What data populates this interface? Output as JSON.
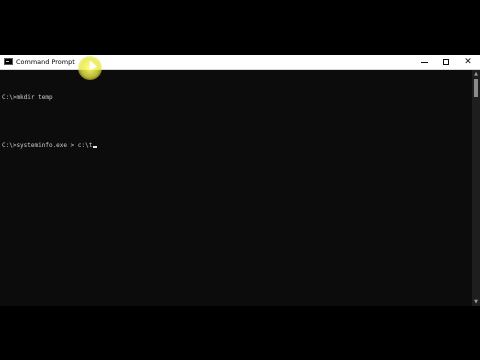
{
  "window": {
    "title": "Command Prompt",
    "controls": {
      "minimize": "minimize",
      "maximize": "maximize",
      "close": "✕"
    }
  },
  "console": {
    "lines": [
      "C:\\>mkdir temp",
      "",
      "C:\\>systeminfo.exe > c:\\t"
    ]
  },
  "scrollbar": {
    "up": "▲",
    "down": "▼"
  },
  "colors": {
    "console_bg": "#0c0c0c",
    "console_text": "#cccccc",
    "titlebar_bg": "#ffffff"
  }
}
